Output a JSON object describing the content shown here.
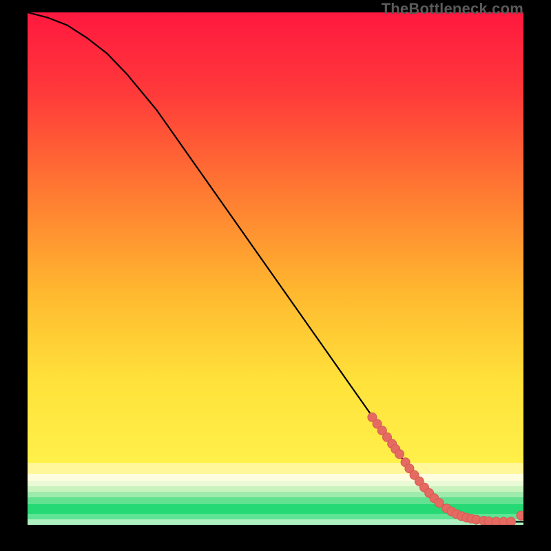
{
  "watermark": "TheBottleneck.com",
  "colors": {
    "curve": "#000000",
    "dot_fill": "#e46a62",
    "dot_stroke": "#d65a52",
    "green_core": "#25d974",
    "green_light": "#b7f2c8",
    "yellow": "#ffea3a",
    "orange": "#ff9f2e",
    "red_top": "#ff183f"
  },
  "chart_data": {
    "type": "line",
    "title": "",
    "xlabel": "",
    "ylabel": "",
    "xlim": [
      0,
      100
    ],
    "ylim": [
      0,
      100
    ],
    "curve": {
      "x": [
        0,
        4,
        8,
        12,
        16,
        20,
        26,
        34,
        42,
        50,
        58,
        66,
        74,
        80,
        85,
        88,
        92,
        96,
        100
      ],
      "y": [
        100,
        99,
        97.5,
        95,
        92,
        88,
        81,
        70,
        59,
        48,
        37,
        26,
        15,
        7,
        3,
        1.5,
        0.8,
        0.6,
        0.6
      ]
    },
    "series": [
      {
        "name": "highlighted-points",
        "type": "scatter",
        "x": [
          69.5,
          70.5,
          71.5,
          72.5,
          73.5,
          74.2,
          75.0,
          76.2,
          77.0,
          78.0,
          79.0,
          80.0,
          81.0,
          82.0,
          83.0,
          84.5,
          85.5,
          86.5,
          87.5,
          88.5,
          89.5,
          90.5,
          92.0,
          93.0,
          94.5,
          96.0,
          97.5,
          99.5
        ],
        "y": [
          21.0,
          19.7,
          18.4,
          17.1,
          15.8,
          14.8,
          13.8,
          12.2,
          11.0,
          9.7,
          8.5,
          7.3,
          6.2,
          5.2,
          4.3,
          3.2,
          2.6,
          2.1,
          1.7,
          1.4,
          1.2,
          1.0,
          0.8,
          0.7,
          0.65,
          0.6,
          0.6,
          1.8
        ]
      }
    ]
  }
}
